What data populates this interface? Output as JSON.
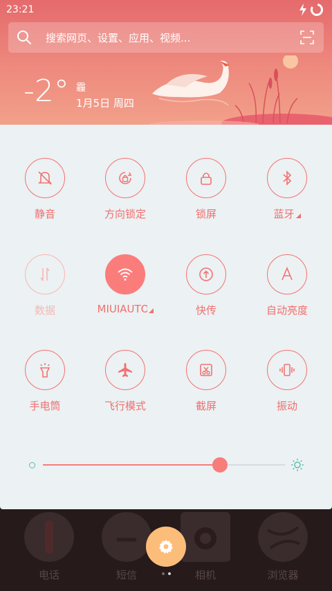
{
  "status": {
    "time": "23:21"
  },
  "search": {
    "placeholder": "搜索网页、设置、应用、视频..."
  },
  "weather": {
    "temperature": "-2°",
    "condition": "霾",
    "date": "1月5日 周四"
  },
  "toggles": [
    {
      "label": "静音",
      "icon": "bell-off-icon",
      "state": "off"
    },
    {
      "label": "方向锁定",
      "icon": "rotation-lock-icon",
      "state": "off"
    },
    {
      "label": "锁屏",
      "icon": "lock-icon",
      "state": "off"
    },
    {
      "label": "蓝牙",
      "icon": "bluetooth-icon",
      "state": "off",
      "has_menu": true
    },
    {
      "label": "数据",
      "icon": "data-arrows-icon",
      "state": "disabled"
    },
    {
      "label": "MIUIAUTO",
      "icon": "wifi-icon",
      "state": "on",
      "has_menu": true
    },
    {
      "label": "快传",
      "icon": "transfer-icon",
      "state": "off"
    },
    {
      "label": "自动亮度",
      "icon": "auto-brightness-icon",
      "state": "off"
    },
    {
      "label": "手电筒",
      "icon": "flashlight-icon",
      "state": "off"
    },
    {
      "label": "飞行模式",
      "icon": "airplane-icon",
      "state": "off"
    },
    {
      "label": "截屏",
      "icon": "screenshot-icon",
      "state": "off"
    },
    {
      "label": "振动",
      "icon": "vibrate-icon",
      "state": "off"
    }
  ],
  "brightness": {
    "level": 0.73
  },
  "dock": {
    "apps": [
      {
        "name": "电话",
        "icon": "phone-icon"
      },
      {
        "name": "短信",
        "icon": "message-icon"
      },
      {
        "name": "相机",
        "icon": "camera-icon"
      },
      {
        "name": "浏览器",
        "icon": "browser-icon"
      }
    ],
    "page_indicator": {
      "current": 2,
      "total": 2
    }
  },
  "colors": {
    "accent": "#f27272",
    "panel": "#ecf1f3",
    "header": "#e56a6c",
    "settings": "#fdbd7a"
  }
}
